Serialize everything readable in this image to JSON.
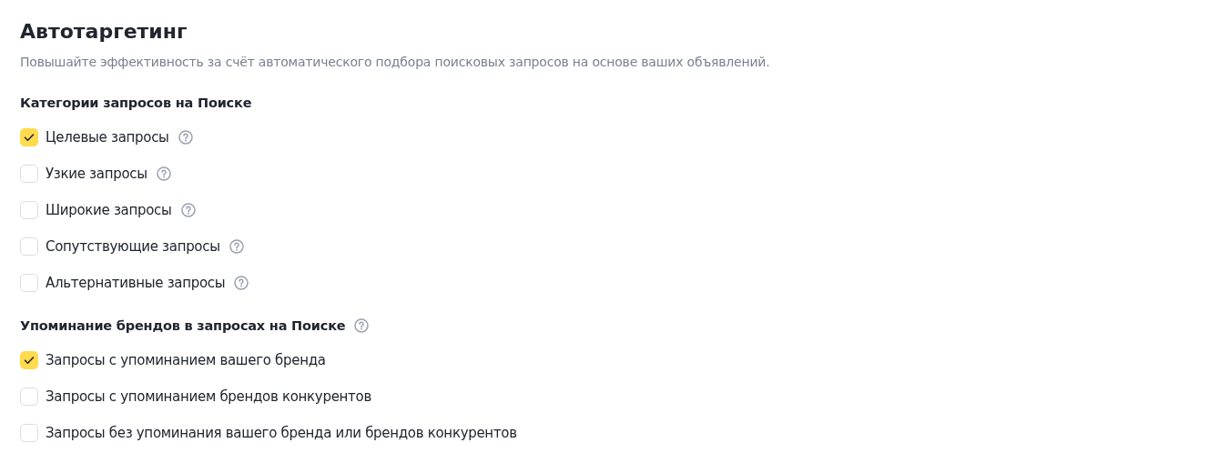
{
  "title": "Автотаргетинг",
  "description": "Повышайте эффективность за счёт автоматического подбора поисковых запросов на основе ваших объявлений.",
  "sections": [
    {
      "heading": "Категории запросов на Поиске",
      "help": false,
      "options": [
        {
          "label": "Целевые запросы",
          "checked": true,
          "help": true
        },
        {
          "label": "Узкие запросы",
          "checked": false,
          "help": true
        },
        {
          "label": "Широкие запросы",
          "checked": false,
          "help": true
        },
        {
          "label": "Сопутствующие запросы",
          "checked": false,
          "help": true
        },
        {
          "label": "Альтернативные запросы",
          "checked": false,
          "help": true
        }
      ]
    },
    {
      "heading": "Упоминание брендов в запросах на Поиске",
      "help": true,
      "options": [
        {
          "label": "Запросы с упоминанием вашего бренда",
          "checked": true,
          "help": false
        },
        {
          "label": "Запросы с упоминанием брендов конкурентов",
          "checked": false,
          "help": false
        },
        {
          "label": "Запросы без упоминания вашего бренда или брендов конкурентов",
          "checked": false,
          "help": false
        }
      ]
    }
  ]
}
